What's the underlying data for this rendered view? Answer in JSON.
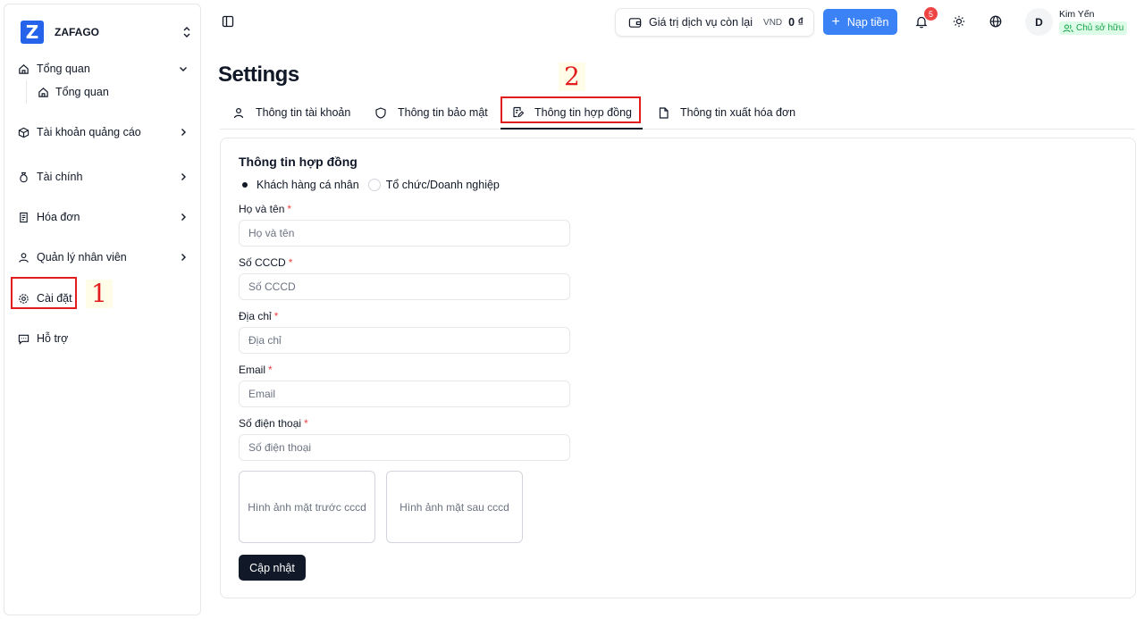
{
  "brand": {
    "name": "ZAFAGO",
    "logo_letter": "Z"
  },
  "sidebar": {
    "items": [
      {
        "label": "Tổng quan",
        "icon": "home-icon"
      },
      {
        "label": "Tổng quan",
        "icon": "home-icon"
      },
      {
        "label": "Tài khoản quảng cáo",
        "icon": "box-icon"
      },
      {
        "label": "Tài chính",
        "icon": "money-bag-icon"
      },
      {
        "label": "Hóa đơn",
        "icon": "receipt-icon"
      },
      {
        "label": "Quản lý nhân viên",
        "icon": "user-icon"
      },
      {
        "label": "Cài đặt",
        "icon": "gear-icon"
      },
      {
        "label": "Hỗ trợ",
        "icon": "chat-icon"
      }
    ]
  },
  "annotations": {
    "first": "1",
    "second": "2"
  },
  "header": {
    "balance_label": "Giá trị dịch vụ còn lại",
    "currency": "VND",
    "balance_amount": "0 ₫",
    "topup_label": "Nạp tiền",
    "notification_count": "5",
    "avatar_letter": "D",
    "user_name": "Kim Yến",
    "user_role": "Chủ sở hữu"
  },
  "page": {
    "title": "Settings",
    "tabs": [
      {
        "label": "Thông tin tài khoản",
        "icon": "user-icon"
      },
      {
        "label": "Thông tin bảo mật",
        "icon": "shield-icon"
      },
      {
        "label": "Thông tin hợp đồng",
        "icon": "contract-edit-icon",
        "active": true
      },
      {
        "label": "Thông tin xuất hóa đơn",
        "icon": "file-icon"
      }
    ]
  },
  "form": {
    "title": "Thông tin hợp đồng",
    "customer_types": [
      "Khách hàng cá nhân",
      "Tổ chức/Doanh nghiệp"
    ],
    "selected_customer_type": "Khách hàng cá nhân",
    "fields": [
      {
        "label": "Họ và tên",
        "placeholder": "Họ và tên",
        "value": ""
      },
      {
        "label": "Số CCCD",
        "placeholder": "Số CCCD",
        "value": ""
      },
      {
        "label": "Địa chỉ",
        "placeholder": "Địa chỉ",
        "value": ""
      },
      {
        "label": "Email",
        "placeholder": "Email",
        "value": ""
      },
      {
        "label": "Số điện thoại",
        "placeholder": "Số điện thoại",
        "value": ""
      }
    ],
    "uploads": [
      "Hình ảnh mặt trước cccd",
      "Hình ảnh mặt sau cccd"
    ],
    "submit_label": "Cập nhật"
  },
  "colors": {
    "accent": "#3b82f6",
    "annotation": "#e11d1d",
    "danger": "#ef4444",
    "success": "#16a34a"
  }
}
